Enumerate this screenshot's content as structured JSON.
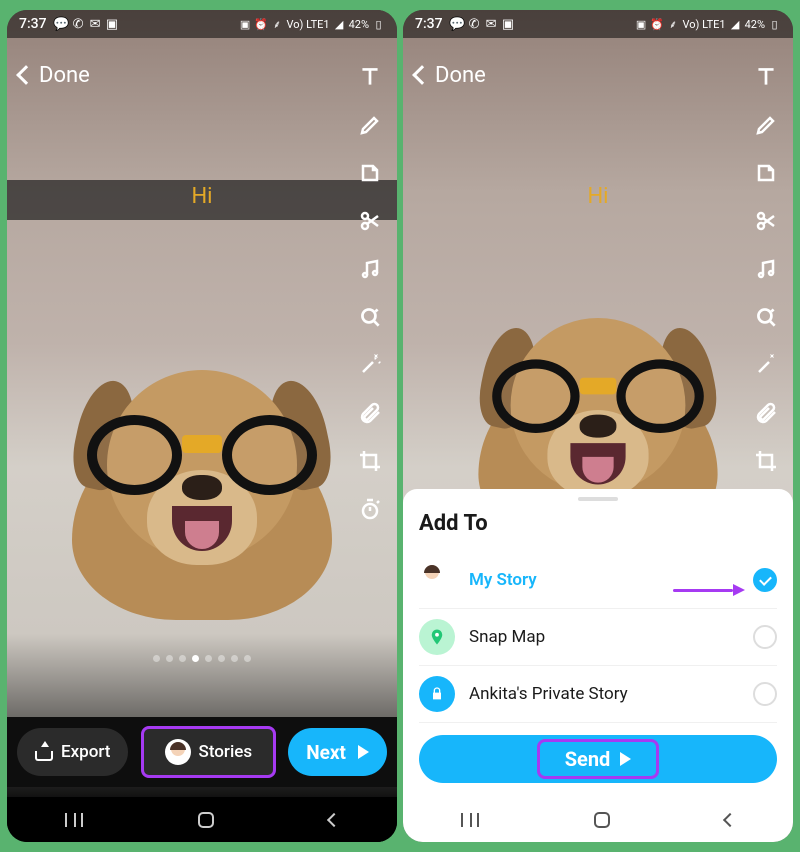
{
  "statusbar": {
    "time": "7:37",
    "battery": "42%",
    "network_label": "Vo) LTE1"
  },
  "topbar": {
    "done": "Done"
  },
  "banner": {
    "text": "Hi"
  },
  "tools": {
    "text": "text-tool",
    "pencil": "draw-tool",
    "sticker": "sticker-tool",
    "scissors": "cut-tool",
    "music": "music-tool",
    "search": "lens-tool",
    "magic": "magic-tool",
    "attach": "attach-tool",
    "crop": "crop-tool",
    "timer": "timer-tool"
  },
  "bottom": {
    "export": "Export",
    "stories": "Stories",
    "next": "Next"
  },
  "sheet": {
    "title": "Add To",
    "items": [
      {
        "label": "My Story",
        "selected": true,
        "icon": "avatar"
      },
      {
        "label": "Snap Map",
        "selected": false,
        "icon": "map-pin"
      },
      {
        "label": "Ankita's Private Story",
        "selected": false,
        "icon": "lock"
      }
    ],
    "send": "Send"
  }
}
